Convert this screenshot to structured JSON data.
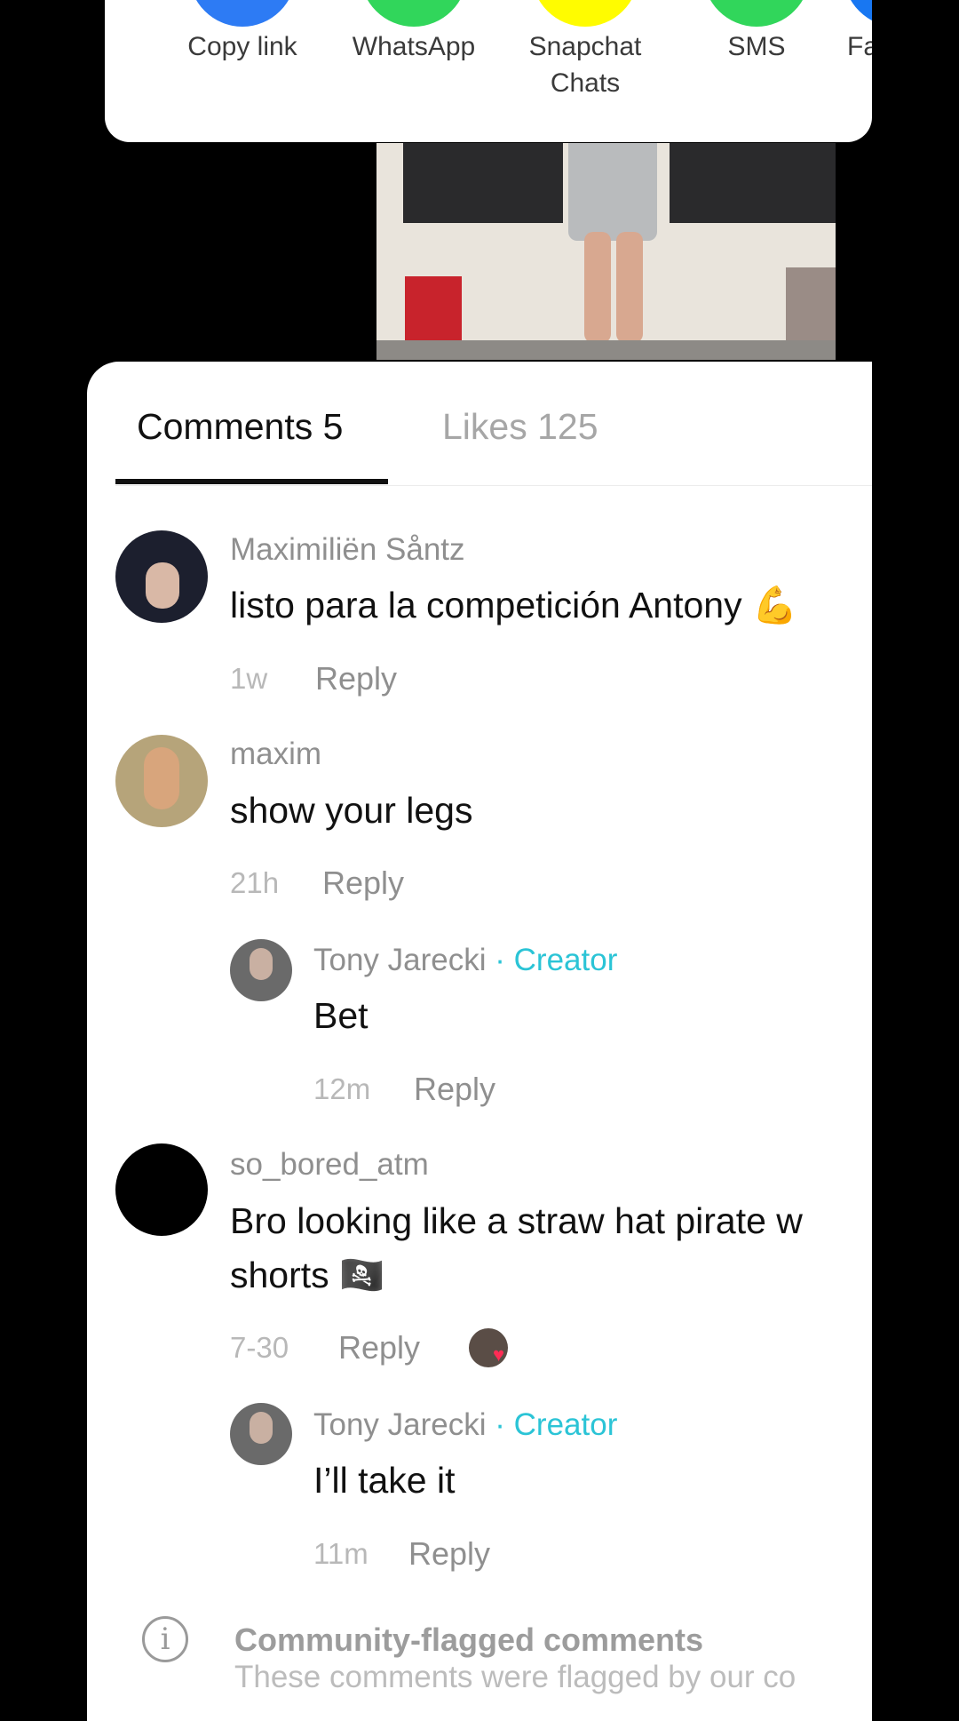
{
  "share": {
    "items": [
      {
        "label": "Copy link",
        "color": "#2d7bf4"
      },
      {
        "label": "WhatsApp",
        "color": "#31d65b"
      },
      {
        "label": "Snapchat Chats",
        "color": "#fffc00"
      },
      {
        "label": "SMS",
        "color": "#31d65b"
      },
      {
        "label": "Fa",
        "color": "#1877f2"
      }
    ]
  },
  "tabs": {
    "comments": "Comments 5",
    "likes": "Likes 125"
  },
  "comments": [
    {
      "name": "Maximiliën Såntz",
      "text": "listo para la competición Antony 💪",
      "time": "1w",
      "reply": "Reply"
    },
    {
      "name": "maxim",
      "text": "show your legs",
      "time": "21h",
      "reply": "Reply"
    },
    {
      "name": "Tony Jarecki",
      "badge": "· Creator",
      "text": "Bet",
      "time": "12m",
      "reply": "Reply"
    },
    {
      "name": "so_bored_atm",
      "text_line1": "Bro looking like a straw hat pirate w",
      "text_line2": "shorts 🏴‍☠️",
      "time": "7-30",
      "reply": "Reply"
    },
    {
      "name": "Tony Jarecki",
      "badge": "· Creator",
      "text": "I’ll take it",
      "time": "11m",
      "reply": "Reply"
    }
  ],
  "flagged": {
    "title": "Community-flagged comments",
    "desc": "These comments were flagged by our co"
  },
  "colors": {
    "accent": "#2bc4d6",
    "like": "#fe2c55"
  }
}
